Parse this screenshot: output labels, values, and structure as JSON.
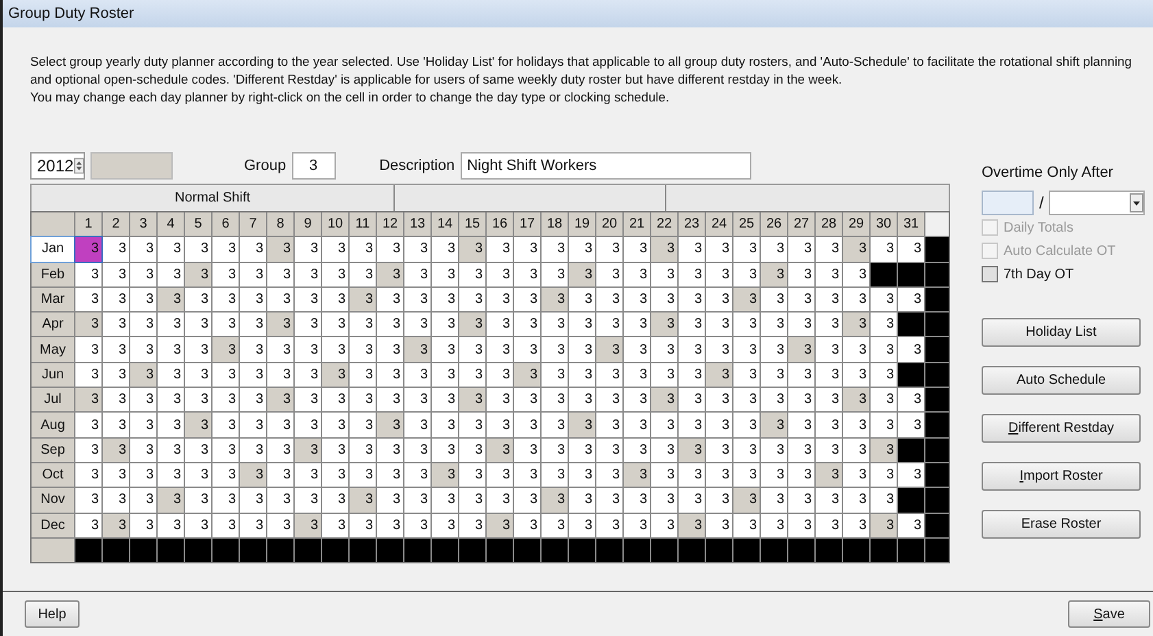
{
  "window": {
    "title": "Group Duty Roster"
  },
  "instructions": [
    "Select group yearly duty planner according to the year selected. Use 'Holiday List' for holidays that applicable to all group duty rosters, and 'Auto-Schedule' to facilitate the rotational shift planning and  optional open-schedule codes. 'Different Restday' is applicable for users of same weekly duty roster but have different restday in the week.",
    "You may change each day planner by right-click on the cell in order to change the day type or clocking schedule."
  ],
  "year": {
    "value": "2012"
  },
  "group": {
    "label": "Group",
    "value": "3"
  },
  "description": {
    "label": "Description",
    "value": "Night Shift Workers"
  },
  "shift_bands": [
    "Normal Shift"
  ],
  "days": [
    "1",
    "2",
    "3",
    "4",
    "5",
    "6",
    "7",
    "8",
    "9",
    "10",
    "11",
    "12",
    "13",
    "14",
    "15",
    "16",
    "17",
    "18",
    "19",
    "20",
    "21",
    "22",
    "23",
    "24",
    "25",
    "26",
    "27",
    "28",
    "29",
    "30",
    "31"
  ],
  "months": [
    {
      "label": "Jan",
      "selected": true,
      "values": [
        "3",
        "3",
        "3",
        "3",
        "3",
        "3",
        "3",
        "3",
        "3",
        "3",
        "3",
        "3",
        "3",
        "3",
        "3",
        "3",
        "3",
        "3",
        "3",
        "3",
        "3",
        "3",
        "3",
        "3",
        "3",
        "3",
        "3",
        "3",
        "3",
        "3",
        "3"
      ],
      "rest": [
        true,
        false,
        false,
        false,
        false,
        false,
        false,
        true,
        false,
        false,
        false,
        false,
        false,
        false,
        true,
        false,
        false,
        false,
        false,
        false,
        false,
        true,
        false,
        false,
        false,
        false,
        false,
        false,
        true,
        false,
        false
      ],
      "selected_cells": [
        true,
        false,
        false,
        false,
        false,
        false,
        false,
        false,
        false,
        false,
        false,
        false,
        false,
        false,
        false,
        false,
        false,
        false,
        false,
        false,
        false,
        false,
        false,
        false,
        false,
        false,
        false,
        false,
        false,
        false,
        false
      ]
    },
    {
      "label": "Feb",
      "selected": false,
      "values": [
        "3",
        "3",
        "3",
        "3",
        "3",
        "3",
        "3",
        "3",
        "3",
        "3",
        "3",
        "3",
        "3",
        "3",
        "3",
        "3",
        "3",
        "3",
        "3",
        "3",
        "3",
        "3",
        "3",
        "3",
        "3",
        "3",
        "3",
        "3",
        "3"
      ],
      "rest": [
        false,
        false,
        false,
        false,
        true,
        false,
        false,
        false,
        false,
        false,
        false,
        true,
        false,
        false,
        false,
        false,
        false,
        false,
        true,
        false,
        false,
        false,
        false,
        false,
        false,
        true,
        false,
        false,
        false
      ],
      "selected_cells": [
        false,
        false,
        false,
        false,
        false,
        false,
        false,
        false,
        false,
        false,
        false,
        false,
        false,
        false,
        false,
        false,
        false,
        false,
        false,
        false,
        false,
        false,
        false,
        false,
        false,
        false,
        false,
        false,
        false
      ]
    },
    {
      "label": "Mar",
      "selected": false,
      "values": [
        "3",
        "3",
        "3",
        "3",
        "3",
        "3",
        "3",
        "3",
        "3",
        "3",
        "3",
        "3",
        "3",
        "3",
        "3",
        "3",
        "3",
        "3",
        "3",
        "3",
        "3",
        "3",
        "3",
        "3",
        "3",
        "3",
        "3",
        "3",
        "3",
        "3",
        "3"
      ],
      "rest": [
        false,
        false,
        false,
        true,
        false,
        false,
        false,
        false,
        false,
        false,
        true,
        false,
        false,
        false,
        false,
        false,
        false,
        true,
        false,
        false,
        false,
        false,
        false,
        false,
        true,
        false,
        false,
        false,
        false,
        false,
        false
      ],
      "selected_cells": [
        false,
        false,
        false,
        false,
        false,
        false,
        false,
        false,
        false,
        false,
        false,
        false,
        false,
        false,
        false,
        false,
        false,
        false,
        false,
        false,
        false,
        false,
        false,
        false,
        false,
        false,
        false,
        false,
        false,
        false,
        false
      ]
    },
    {
      "label": "Apr",
      "selected": false,
      "values": [
        "3",
        "3",
        "3",
        "3",
        "3",
        "3",
        "3",
        "3",
        "3",
        "3",
        "3",
        "3",
        "3",
        "3",
        "3",
        "3",
        "3",
        "3",
        "3",
        "3",
        "3",
        "3",
        "3",
        "3",
        "3",
        "3",
        "3",
        "3",
        "3",
        "3"
      ],
      "rest": [
        true,
        false,
        false,
        false,
        false,
        false,
        false,
        true,
        false,
        false,
        false,
        false,
        false,
        false,
        true,
        false,
        false,
        false,
        false,
        false,
        false,
        true,
        false,
        false,
        false,
        false,
        false,
        false,
        true,
        false
      ],
      "selected_cells": [
        false,
        false,
        false,
        false,
        false,
        false,
        false,
        false,
        false,
        false,
        false,
        false,
        false,
        false,
        false,
        false,
        false,
        false,
        false,
        false,
        false,
        false,
        false,
        false,
        false,
        false,
        false,
        false,
        false,
        false
      ]
    },
    {
      "label": "May",
      "selected": false,
      "values": [
        "3",
        "3",
        "3",
        "3",
        "3",
        "3",
        "3",
        "3",
        "3",
        "3",
        "3",
        "3",
        "3",
        "3",
        "3",
        "3",
        "3",
        "3",
        "3",
        "3",
        "3",
        "3",
        "3",
        "3",
        "3",
        "3",
        "3",
        "3",
        "3",
        "3",
        "3"
      ],
      "rest": [
        false,
        false,
        false,
        false,
        false,
        true,
        false,
        false,
        false,
        false,
        false,
        false,
        true,
        false,
        false,
        false,
        false,
        false,
        false,
        true,
        false,
        false,
        false,
        false,
        false,
        false,
        true,
        false,
        false,
        false,
        false
      ],
      "selected_cells": [
        false,
        false,
        false,
        false,
        false,
        false,
        false,
        false,
        false,
        false,
        false,
        false,
        false,
        false,
        false,
        false,
        false,
        false,
        false,
        false,
        false,
        false,
        false,
        false,
        false,
        false,
        false,
        false,
        false,
        false,
        false
      ]
    },
    {
      "label": "Jun",
      "selected": false,
      "values": [
        "3",
        "3",
        "3",
        "3",
        "3",
        "3",
        "3",
        "3",
        "3",
        "3",
        "3",
        "3",
        "3",
        "3",
        "3",
        "3",
        "3",
        "3",
        "3",
        "3",
        "3",
        "3",
        "3",
        "3",
        "3",
        "3",
        "3",
        "3",
        "3",
        "3"
      ],
      "rest": [
        false,
        false,
        true,
        false,
        false,
        false,
        false,
        false,
        false,
        true,
        false,
        false,
        false,
        false,
        false,
        false,
        true,
        false,
        false,
        false,
        false,
        false,
        false,
        true,
        false,
        false,
        false,
        false,
        false,
        false
      ],
      "selected_cells": [
        false,
        false,
        false,
        false,
        false,
        false,
        false,
        false,
        false,
        false,
        false,
        false,
        false,
        false,
        false,
        false,
        false,
        false,
        false,
        false,
        false,
        false,
        false,
        false,
        false,
        false,
        false,
        false,
        false,
        false
      ]
    },
    {
      "label": "Jul",
      "selected": false,
      "values": [
        "3",
        "3",
        "3",
        "3",
        "3",
        "3",
        "3",
        "3",
        "3",
        "3",
        "3",
        "3",
        "3",
        "3",
        "3",
        "3",
        "3",
        "3",
        "3",
        "3",
        "3",
        "3",
        "3",
        "3",
        "3",
        "3",
        "3",
        "3",
        "3",
        "3",
        "3"
      ],
      "rest": [
        true,
        false,
        false,
        false,
        false,
        false,
        false,
        true,
        false,
        false,
        false,
        false,
        false,
        false,
        true,
        false,
        false,
        false,
        false,
        false,
        false,
        true,
        false,
        false,
        false,
        false,
        false,
        false,
        true,
        false,
        false
      ],
      "selected_cells": [
        false,
        false,
        false,
        false,
        false,
        false,
        false,
        false,
        false,
        false,
        false,
        false,
        false,
        false,
        false,
        false,
        false,
        false,
        false,
        false,
        false,
        false,
        false,
        false,
        false,
        false,
        false,
        false,
        false,
        false,
        false
      ]
    },
    {
      "label": "Aug",
      "selected": false,
      "values": [
        "3",
        "3",
        "3",
        "3",
        "3",
        "3",
        "3",
        "3",
        "3",
        "3",
        "3",
        "3",
        "3",
        "3",
        "3",
        "3",
        "3",
        "3",
        "3",
        "3",
        "3",
        "3",
        "3",
        "3",
        "3",
        "3",
        "3",
        "3",
        "3",
        "3",
        "3"
      ],
      "rest": [
        false,
        false,
        false,
        false,
        true,
        false,
        false,
        false,
        false,
        false,
        false,
        true,
        false,
        false,
        false,
        false,
        false,
        false,
        true,
        false,
        false,
        false,
        false,
        false,
        false,
        true,
        false,
        false,
        false,
        false,
        false
      ],
      "selected_cells": [
        false,
        false,
        false,
        false,
        false,
        false,
        false,
        false,
        false,
        false,
        false,
        false,
        false,
        false,
        false,
        false,
        false,
        false,
        false,
        false,
        false,
        false,
        false,
        false,
        false,
        false,
        false,
        false,
        false,
        false,
        false
      ]
    },
    {
      "label": "Sep",
      "selected": false,
      "values": [
        "3",
        "3",
        "3",
        "3",
        "3",
        "3",
        "3",
        "3",
        "3",
        "3",
        "3",
        "3",
        "3",
        "3",
        "3",
        "3",
        "3",
        "3",
        "3",
        "3",
        "3",
        "3",
        "3",
        "3",
        "3",
        "3",
        "3",
        "3",
        "3",
        "3"
      ],
      "rest": [
        false,
        true,
        false,
        false,
        false,
        false,
        false,
        false,
        true,
        false,
        false,
        false,
        false,
        false,
        false,
        true,
        false,
        false,
        false,
        false,
        false,
        false,
        true,
        false,
        false,
        false,
        false,
        false,
        false,
        true
      ],
      "selected_cells": [
        false,
        false,
        false,
        false,
        false,
        false,
        false,
        false,
        false,
        false,
        false,
        false,
        false,
        false,
        false,
        false,
        false,
        false,
        false,
        false,
        false,
        false,
        false,
        false,
        false,
        false,
        false,
        false,
        false,
        false
      ]
    },
    {
      "label": "Oct",
      "selected": false,
      "values": [
        "3",
        "3",
        "3",
        "3",
        "3",
        "3",
        "3",
        "3",
        "3",
        "3",
        "3",
        "3",
        "3",
        "3",
        "3",
        "3",
        "3",
        "3",
        "3",
        "3",
        "3",
        "3",
        "3",
        "3",
        "3",
        "3",
        "3",
        "3",
        "3",
        "3",
        "3"
      ],
      "rest": [
        false,
        false,
        false,
        false,
        false,
        false,
        true,
        false,
        false,
        false,
        false,
        false,
        false,
        true,
        false,
        false,
        false,
        false,
        false,
        false,
        true,
        false,
        false,
        false,
        false,
        false,
        false,
        true,
        false,
        false,
        false
      ],
      "selected_cells": [
        false,
        false,
        false,
        false,
        false,
        false,
        false,
        false,
        false,
        false,
        false,
        false,
        false,
        false,
        false,
        false,
        false,
        false,
        false,
        false,
        false,
        false,
        false,
        false,
        false,
        false,
        false,
        false,
        false,
        false,
        false
      ]
    },
    {
      "label": "Nov",
      "selected": false,
      "values": [
        "3",
        "3",
        "3",
        "3",
        "3",
        "3",
        "3",
        "3",
        "3",
        "3",
        "3",
        "3",
        "3",
        "3",
        "3",
        "3",
        "3",
        "3",
        "3",
        "3",
        "3",
        "3",
        "3",
        "3",
        "3",
        "3",
        "3",
        "3",
        "3",
        "3"
      ],
      "rest": [
        false,
        false,
        false,
        true,
        false,
        false,
        false,
        false,
        false,
        false,
        true,
        false,
        false,
        false,
        false,
        false,
        false,
        true,
        false,
        false,
        false,
        false,
        false,
        false,
        true,
        false,
        false,
        false,
        false,
        false
      ],
      "selected_cells": [
        false,
        false,
        false,
        false,
        false,
        false,
        false,
        false,
        false,
        false,
        false,
        false,
        false,
        false,
        false,
        false,
        false,
        false,
        false,
        false,
        false,
        false,
        false,
        false,
        false,
        false,
        false,
        false,
        false,
        false
      ]
    },
    {
      "label": "Dec",
      "selected": false,
      "values": [
        "3",
        "3",
        "3",
        "3",
        "3",
        "3",
        "3",
        "3",
        "3",
        "3",
        "3",
        "3",
        "3",
        "3",
        "3",
        "3",
        "3",
        "3",
        "3",
        "3",
        "3",
        "3",
        "3",
        "3",
        "3",
        "3",
        "3",
        "3",
        "3",
        "3",
        "3"
      ],
      "rest": [
        false,
        true,
        false,
        false,
        false,
        false,
        false,
        false,
        true,
        false,
        false,
        false,
        false,
        false,
        false,
        true,
        false,
        false,
        false,
        false,
        false,
        false,
        true,
        false,
        false,
        false,
        false,
        false,
        false,
        true,
        false
      ],
      "selected_cells": [
        false,
        false,
        false,
        false,
        false,
        false,
        false,
        false,
        false,
        false,
        false,
        false,
        false,
        false,
        false,
        false,
        false,
        false,
        false,
        false,
        false,
        false,
        false,
        false,
        false,
        false,
        false,
        false,
        false,
        false,
        false
      ]
    }
  ],
  "overtime": {
    "label": "Overtime Only After",
    "separator": "/"
  },
  "options": [
    {
      "label": "Daily Totals",
      "checked": false,
      "disabled": true
    },
    {
      "label": "Auto Calculate OT",
      "checked": false,
      "disabled": true
    },
    {
      "label": "7th Day OT",
      "checked": false,
      "disabled": false
    }
  ],
  "actions": [
    {
      "label": "Holiday List",
      "mnemonic": false
    },
    {
      "label": "Auto Schedule",
      "mnemonic": false
    },
    {
      "label": "Different Restday",
      "mnemonic": true
    },
    {
      "label": "Import Roster",
      "mnemonic": true
    },
    {
      "label": "Erase Roster",
      "mnemonic": false
    }
  ],
  "footer": {
    "help": {
      "label": "Help",
      "mnemonic": false
    },
    "save": {
      "label": "Save",
      "mnemonic": true
    }
  }
}
